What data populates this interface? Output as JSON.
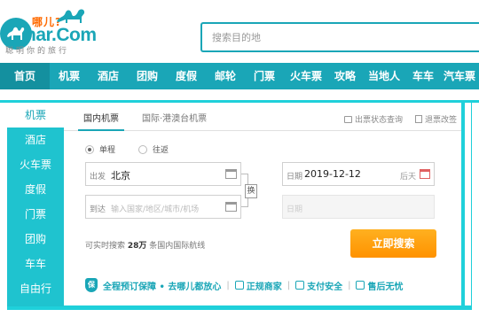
{
  "header": {
    "logo_cn": "哪儿?",
    "logo_en": "nar.Com",
    "slogan": "聪明你的旅行",
    "search_placeholder": "搜索目的地"
  },
  "nav": {
    "items": [
      "首页",
      "机票",
      "酒店",
      "团购",
      "度假",
      "邮轮",
      "门票",
      "火车票",
      "攻略",
      "当地人",
      "车车",
      "汽车票"
    ],
    "active": "首页"
  },
  "sidebar": {
    "items": [
      "机票",
      "酒店",
      "火车票",
      "度假",
      "门票",
      "团购",
      "车车",
      "自由行"
    ],
    "active": "机票"
  },
  "tabs": {
    "domestic": "国内机票",
    "international": "国际·港澳台机票",
    "status_link": "出票状态查询",
    "refund_link": "退票改签"
  },
  "trip_type": {
    "one_way": "单程",
    "round_trip": "往返",
    "selected": "单程"
  },
  "form": {
    "depart_label": "出发",
    "depart_value": "北京",
    "arrive_label": "到达",
    "arrive_placeholder": "输入国家/地区/城市/机场",
    "swap_label": "换",
    "date_label": "日期",
    "date_value": "2019-12-12",
    "date_weekday": "后天",
    "return_label": "日期"
  },
  "hint": {
    "prefix": "可实时搜索",
    "count": "28万",
    "suffix": "条国内国际航线"
  },
  "search_button": "立即搜索",
  "trust": {
    "shield": "保",
    "guarantee": "全程预订保障 • 去哪儿都放心",
    "merchant": "正规商家",
    "payment": "支付安全",
    "after_sale": "售后无忧"
  },
  "colors": {
    "brand": "#1aa6b7",
    "accent": "#ff9a00",
    "panel_border": "#1fd0da"
  }
}
